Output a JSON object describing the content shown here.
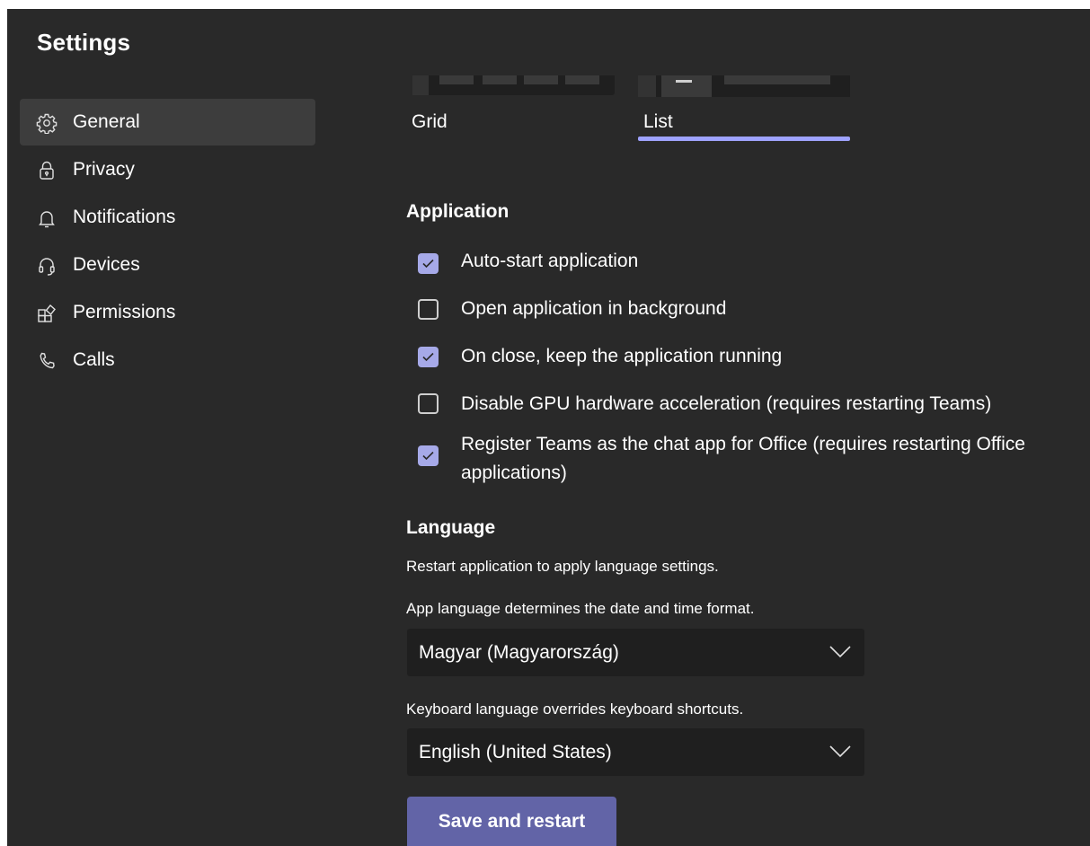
{
  "title": "Settings",
  "nav": [
    {
      "label": "General",
      "icon": "gear-icon",
      "active": true
    },
    {
      "label": "Privacy",
      "icon": "lock-icon",
      "active": false
    },
    {
      "label": "Notifications",
      "icon": "bell-icon",
      "active": false
    },
    {
      "label": "Devices",
      "icon": "headset-icon",
      "active": false
    },
    {
      "label": "Permissions",
      "icon": "apps-icon",
      "active": false
    },
    {
      "label": "Calls",
      "icon": "phone-icon",
      "active": false
    }
  ],
  "layout": {
    "options": [
      {
        "label": "Grid",
        "selected": false
      },
      {
        "label": "List",
        "selected": true
      }
    ],
    "selected_color": "#9ea2ff"
  },
  "application": {
    "heading": "Application",
    "options": [
      {
        "label": "Auto-start application",
        "checked": true
      },
      {
        "label": "Open application in background",
        "checked": false
      },
      {
        "label": "On close, keep the application running",
        "checked": true
      },
      {
        "label": "Disable GPU hardware acceleration (requires restarting Teams)",
        "checked": false
      },
      {
        "label": "Register Teams as the chat app for Office (requires restarting Office applications)",
        "checked": true
      }
    ]
  },
  "language": {
    "heading": "Language",
    "restart_note": "Restart application to apply language settings.",
    "app_language_note": "App language determines the date and time format.",
    "app_language_value": "Magyar (Magyarország)",
    "keyboard_language_note": "Keyboard language overrides keyboard shortcuts.",
    "keyboard_language_value": "English (United States)"
  },
  "save_button": "Save and restart",
  "colors": {
    "background": "#292929",
    "accent": "#6264a7",
    "checkbox_checked": "#a6a9e8",
    "active_nav": "#3d3d3d"
  }
}
